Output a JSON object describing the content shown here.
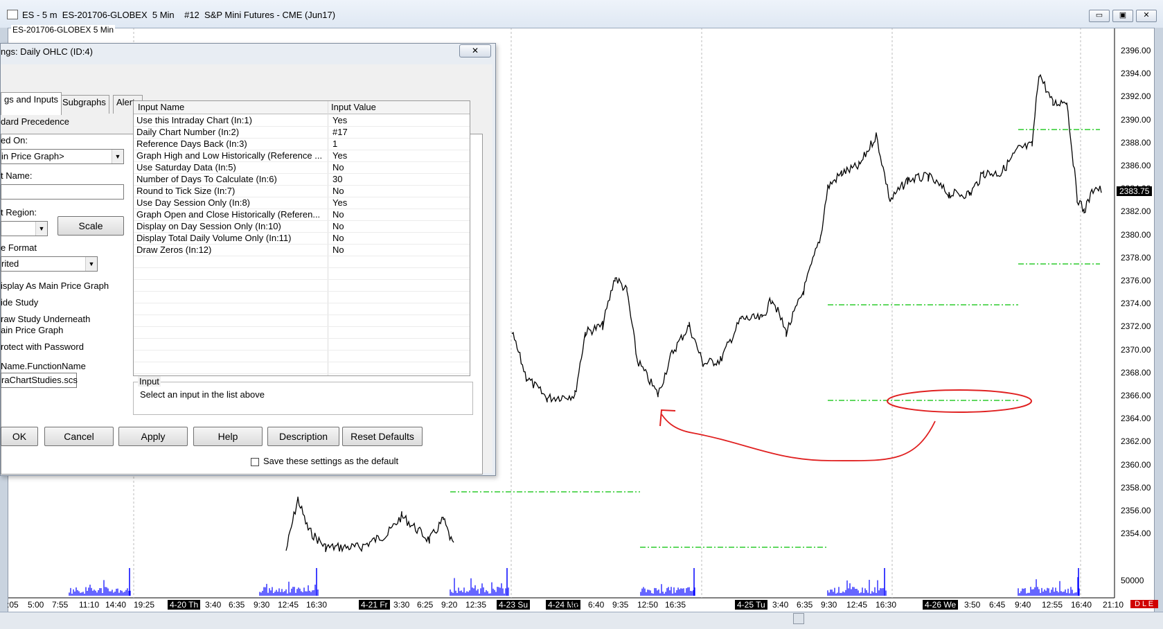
{
  "window": {
    "title": "ES - 5 m  ES-201706-GLOBEX  5 Min    #12  S&P Mini Futures - CME (Jun17)",
    "subtitle": "ES-201706-GLOBEX 5 Min",
    "minimize": "▭",
    "restore": "▣",
    "close": "✕"
  },
  "chart": {
    "current_price": "2383.75",
    "price_labels": [
      "2396.00",
      "2394.00",
      "2392.00",
      "2390.00",
      "2388.00",
      "2386.00",
      "2384.00",
      "2382.00",
      "2380.00",
      "2378.00",
      "2376.00",
      "2374.00",
      "2372.00",
      "2370.00",
      "2368.00",
      "2366.00",
      "2364.00",
      "2362.00",
      "2360.00",
      "2358.00",
      "2356.00",
      "2354.00"
    ],
    "volume_label": "50000",
    "status_badge": "D L E",
    "time_labels": [
      {
        "text": ":05",
        "hl": false
      },
      {
        "text": "5:00",
        "hl": false
      },
      {
        "text": "7:55",
        "hl": false
      },
      {
        "text": "11:10",
        "hl": false
      },
      {
        "text": "14:40",
        "hl": false
      },
      {
        "text": "19:25",
        "hl": false
      },
      {
        "text": "4-20 Th",
        "hl": true
      },
      {
        "text": "3:40",
        "hl": false
      },
      {
        "text": "6:35",
        "hl": false
      },
      {
        "text": "9:30",
        "hl": false
      },
      {
        "text": "12:45",
        "hl": false
      },
      {
        "text": "16:30",
        "hl": false
      },
      {
        "text": "4-21 Fr",
        "hl": true
      },
      {
        "text": "3:30",
        "hl": false
      },
      {
        "text": "6:25",
        "hl": false
      },
      {
        "text": "9:20",
        "hl": false
      },
      {
        "text": "12:35",
        "hl": false
      },
      {
        "text": "4-23 Su",
        "hl": true
      },
      {
        "text": "4-24 Mo",
        "hl": true
      },
      {
        "text": "3:45",
        "hl": false
      },
      {
        "text": "6:40",
        "hl": false
      },
      {
        "text": "9:35",
        "hl": false
      },
      {
        "text": "12:50",
        "hl": false
      },
      {
        "text": "16:35",
        "hl": false
      },
      {
        "text": "4-25 Tu",
        "hl": true
      },
      {
        "text": "3:40",
        "hl": false
      },
      {
        "text": "6:35",
        "hl": false
      },
      {
        "text": "9:30",
        "hl": false
      },
      {
        "text": "12:45",
        "hl": false
      },
      {
        "text": "16:30",
        "hl": false
      },
      {
        "text": "4-26 We",
        "hl": true
      },
      {
        "text": "3:50",
        "hl": false
      },
      {
        "text": "6:45",
        "hl": false
      },
      {
        "text": "9:40",
        "hl": false
      },
      {
        "text": "12:55",
        "hl": false
      },
      {
        "text": "16:40",
        "hl": false
      },
      {
        "text": "21:10",
        "hl": false
      }
    ],
    "colors": {
      "price": "#000000",
      "volume": "#0000ff",
      "ohlc_lines": "#00c000",
      "annotation": "#e02020"
    }
  },
  "dialog": {
    "title": "ngs: Daily OHLC (ID:4)",
    "close": "✕",
    "tabs": [
      "gs and Inputs",
      "Subgraphs",
      "Alerts"
    ],
    "left": {
      "precedence": "dard Precedence",
      "based_on_label": "ed On:",
      "based_on_value": "in Price Graph>",
      "name_label": "t Name:",
      "name_value": "",
      "region_label": "t Region:",
      "region_value": "",
      "scale_button": "Scale",
      "format_label": "e Format",
      "format_value": "rited",
      "opt_main_graph": "isplay As Main Price Graph",
      "opt_hide": "ide Study",
      "opt_underneath_1": "raw Study Underneath",
      "opt_underneath_2": "ain Price Graph",
      "opt_password": "rotect with Password",
      "function_label": "Name.FunctionName",
      "function_value": "raChartStudies.scs"
    },
    "grid": {
      "col_name": "Input Name",
      "col_value": "Input Value",
      "rows": [
        {
          "name": "Use this Intraday Chart  (In:1)",
          "value": "Yes"
        },
        {
          "name": "Daily Chart Number  (In:2)",
          "value": "#17"
        },
        {
          "name": "Reference Days Back  (In:3)",
          "value": "1"
        },
        {
          "name": "Graph High and Low Historically (Reference ...",
          "value": "Yes"
        },
        {
          "name": "Use Saturday Data  (In:5)",
          "value": "No"
        },
        {
          "name": "Number of Days To Calculate  (In:6)",
          "value": "30"
        },
        {
          "name": "Round to Tick Size  (In:7)",
          "value": "No"
        },
        {
          "name": "Use Day Session Only  (In:8)",
          "value": "Yes"
        },
        {
          "name": "Graph Open and Close Historically (Referen...",
          "value": "No"
        },
        {
          "name": "Display on Day Session Only  (In:10)",
          "value": "No"
        },
        {
          "name": "Display Total Daily Volume Only  (In:11)",
          "value": "No"
        },
        {
          "name": "Draw Zeros  (In:12)",
          "value": "No"
        }
      ]
    },
    "input_group": {
      "title": "Input",
      "text": "Select an input in the list above"
    },
    "buttons": {
      "ok": "OK",
      "cancel": "Cancel",
      "apply": "Apply",
      "help": "Help",
      "description": "Description",
      "reset": "Reset Defaults"
    },
    "save_default": "Save these settings as the default"
  }
}
